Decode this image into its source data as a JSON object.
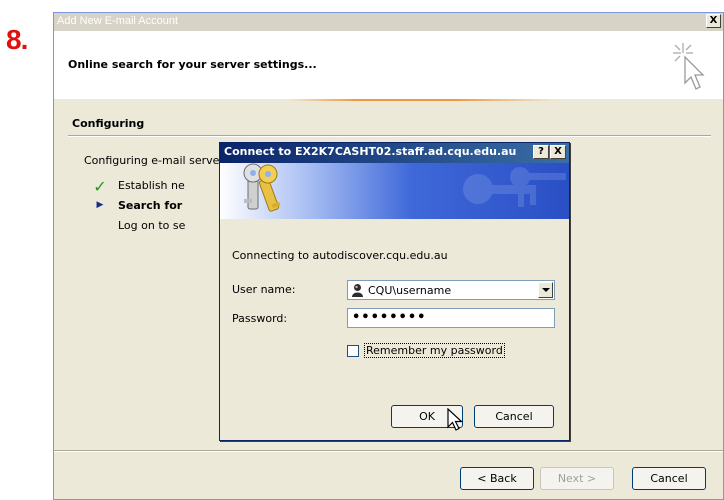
{
  "step_label": "8.",
  "wizard": {
    "title": "Add New E-mail Account",
    "close_glyph": "X",
    "header_title": "Online search for your server settings...",
    "section_title": "Configuring",
    "description": "Configuring e-mail server s",
    "steps": [
      {
        "label": "Establish ne",
        "status": "done"
      },
      {
        "label": "Search for",
        "status": "current"
      },
      {
        "label": "Log on to se",
        "status": "pending"
      }
    ],
    "buttons": {
      "back": "< Back",
      "next": "Next >",
      "cancel": "Cancel"
    }
  },
  "dialog": {
    "title": "Connect to EX2K7CASHT02.staff.ad.cqu.edu.au",
    "help_glyph": "?",
    "close_glyph": "X",
    "connecting_text": "Connecting to autodiscover.cqu.edu.au",
    "username_label": "User name:",
    "username_value": "CQU\\username",
    "password_label": "Password:",
    "password_value": "••••••••",
    "remember_label": "Remember my password",
    "remember_checked": false,
    "ok_label": "OK",
    "cancel_label": "Cancel"
  },
  "colors": {
    "step_number": "#e01010",
    "dialog_title_bar": "#0a246a",
    "check": "#1e9a1e"
  },
  "icons": [
    "cursor-sparkle-icon",
    "keys-icon",
    "user-icon",
    "check-icon",
    "arrow-right-icon",
    "mouse-pointer-icon"
  ]
}
